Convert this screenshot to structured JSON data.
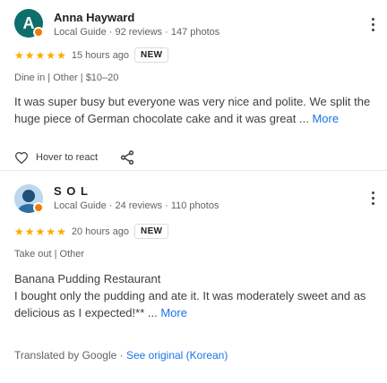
{
  "reviews": [
    {
      "avatar_letter": "A",
      "author": "Anna Hayward",
      "meta": "Local Guide · 92 reviews · 147 photos",
      "rating": 5,
      "time": "15 hours ago",
      "badge": "NEW",
      "context": "Dine in | Other | $10–20",
      "text": "It was super busy but everyone was very nice and polite. We split the huge piece of German chocolate cake and it was great ...",
      "more": "More",
      "react_label": "Hover to react"
    },
    {
      "author": "S O L",
      "meta": "Local Guide · 24 reviews · 110 photos",
      "rating": 5,
      "time": "20 hours ago",
      "badge": "NEW",
      "context": "Take out | Other",
      "title_line": "Banana Pudding Restaurant",
      "text": "I bought only the pudding and ate it. It was moderately sweet and as delicious as I expected!** ...",
      "more": "More",
      "translated_prefix": "Translated by Google · ",
      "translated_link": "See original (Korean)"
    }
  ],
  "colors": {
    "star": "#f9ab00",
    "link": "#1a73e8",
    "avatar_a": "#0e6e6b",
    "guide_badge": "#f57c00"
  },
  "icons": [
    "heart-icon",
    "share-icon",
    "more-vert-icon",
    "star-icon"
  ]
}
